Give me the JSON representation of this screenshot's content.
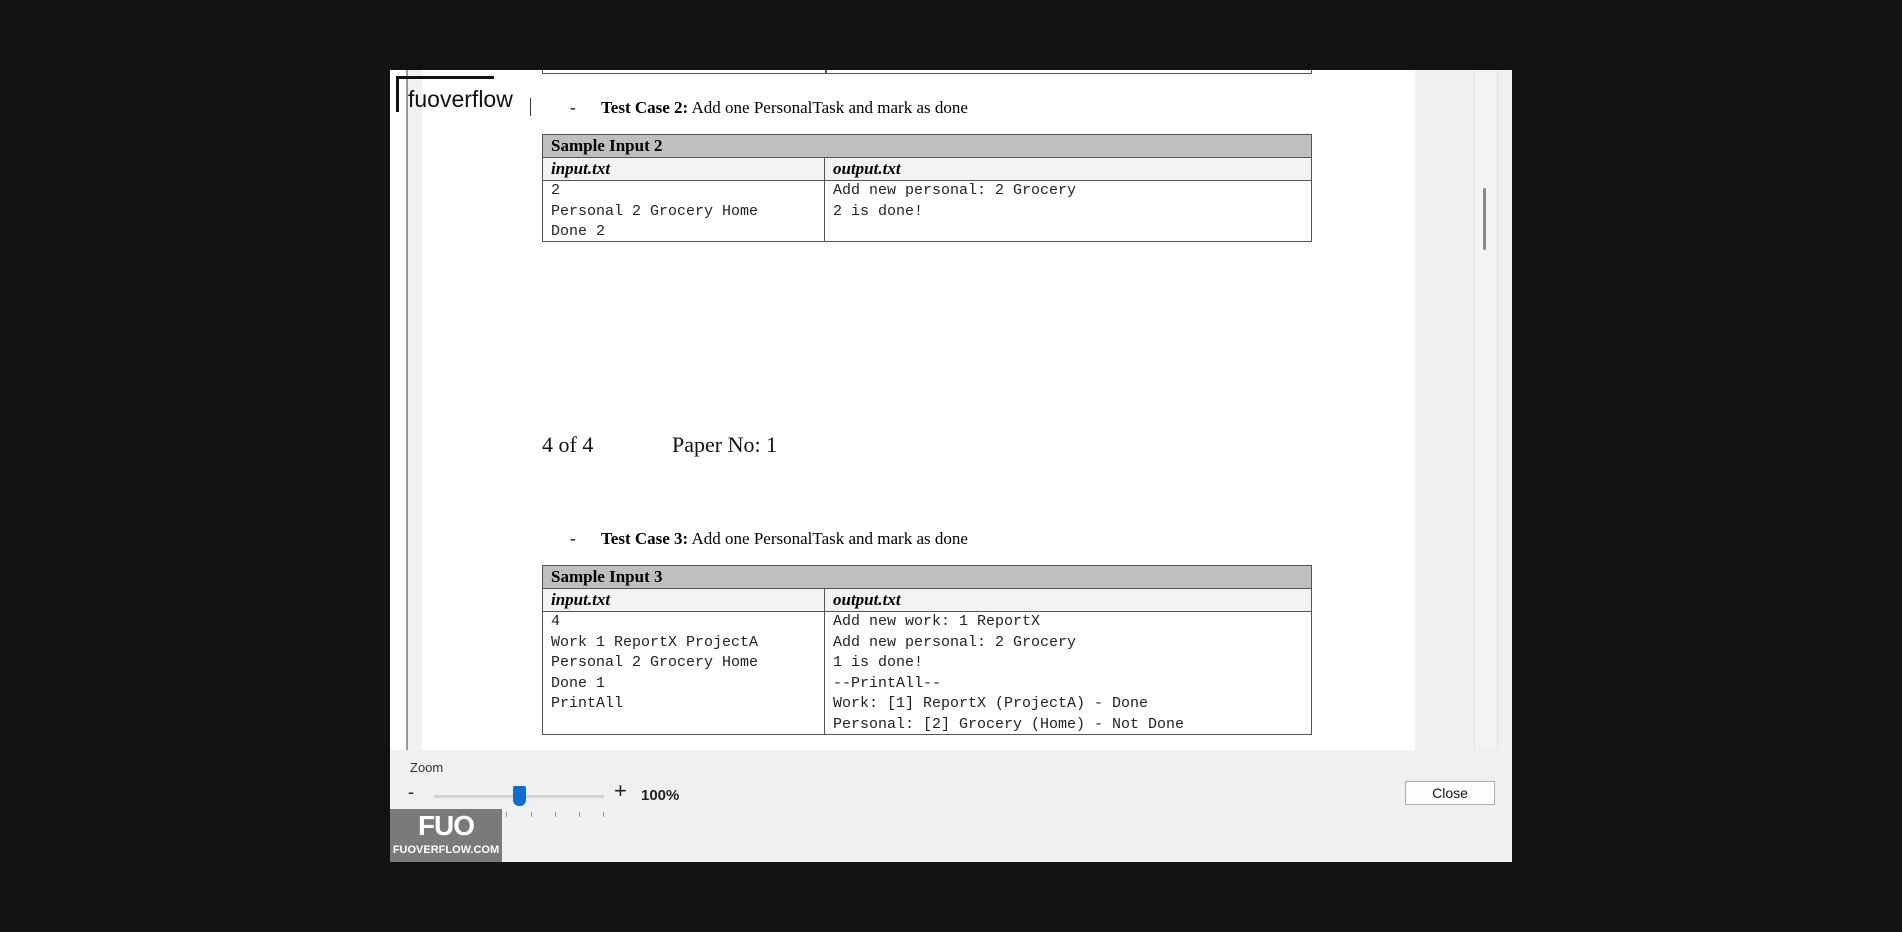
{
  "watermark": {
    "text": "fuoverflow"
  },
  "document": {
    "test_case_2": {
      "dash": "-",
      "label": "Test Case 2:",
      "description": " Add one PersonalTask and mark as done"
    },
    "sample_2": {
      "title": "Sample Input 2",
      "input_header": "input.txt",
      "output_header": "output.txt",
      "input_lines": [
        "2",
        "Personal 2 Grocery Home",
        "Done 2"
      ],
      "output_lines": [
        "Add new personal: 2 Grocery",
        "2 is done!"
      ]
    },
    "page_footer": {
      "page": "4 of 4",
      "paper": "Paper No: 1"
    },
    "test_case_3": {
      "dash": "-",
      "label": "Test Case 3:",
      "description": " Add one PersonalTask and mark as done"
    },
    "sample_3": {
      "title": "Sample Input 3",
      "input_header": "input.txt",
      "output_header": "output.txt",
      "input_lines": [
        "4",
        "Work 1 ReportX ProjectA",
        "Personal 2 Grocery Home",
        "Done 1",
        "PrintAll"
      ],
      "output_lines": [
        "Add new work: 1 ReportX",
        "Add new personal: 2 Grocery",
        "1 is done!",
        "--PrintAll--",
        "Work: [1] ReportX (ProjectA) - Done",
        "Personal: [2] Grocery (Home) - Not Done"
      ]
    }
  },
  "zoom": {
    "label": "Zoom",
    "minus": "-",
    "plus": "+",
    "value": "100%",
    "level_fraction": 0.5
  },
  "close_button": "Close",
  "logo": {
    "mark": "FUO",
    "site": "FUOVERFLOW.COM"
  },
  "colors": {
    "slider_accent": "#0a6fd0",
    "table_header_bg": "#bfbfbf"
  }
}
